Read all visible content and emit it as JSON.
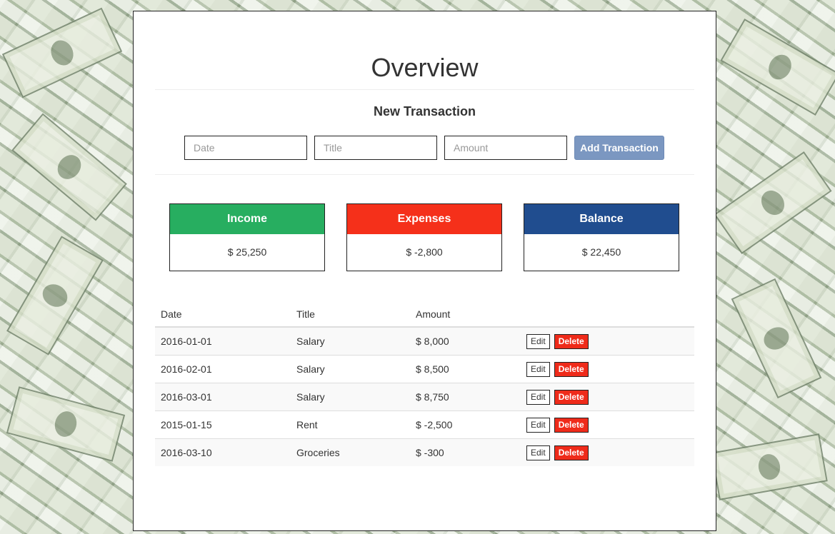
{
  "page": {
    "title": "Overview",
    "form_heading": "New Transaction"
  },
  "form": {
    "date_placeholder": "Date",
    "title_placeholder": "Title",
    "amount_placeholder": "Amount",
    "add_label": "Add Transaction"
  },
  "summary": {
    "income": {
      "label": "Income",
      "value": "$ 25,250",
      "color": "#27ae60"
    },
    "expenses": {
      "label": "Expenses",
      "value": "$ -2,800",
      "color": "#f5301a"
    },
    "balance": {
      "label": "Balance",
      "value": "$ 22,450",
      "color": "#204d8f"
    }
  },
  "table": {
    "headers": {
      "date": "Date",
      "title": "Title",
      "amount": "Amount"
    },
    "rows": [
      {
        "date": "2016-01-01",
        "title": "Salary",
        "amount": "$ 8,000"
      },
      {
        "date": "2016-02-01",
        "title": "Salary",
        "amount": "$ 8,500"
      },
      {
        "date": "2016-03-01",
        "title": "Salary",
        "amount": "$ 8,750"
      },
      {
        "date": "2015-01-15",
        "title": "Rent",
        "amount": "$ -2,500"
      },
      {
        "date": "2016-03-10",
        "title": "Groceries",
        "amount": "$ -300"
      }
    ],
    "edit_label": "Edit",
    "delete_label": "Delete"
  }
}
